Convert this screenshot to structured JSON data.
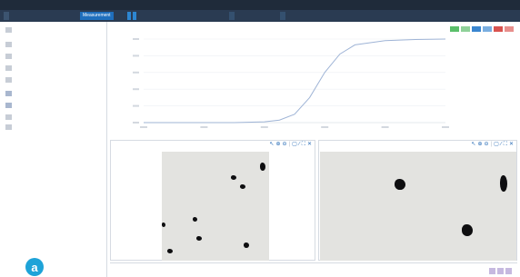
{
  "window": {
    "title": "",
    "controls": [
      "",
      "",
      "",
      ""
    ]
  },
  "tabs": [
    {
      "label": ""
    },
    {
      "label": "Measurement"
    },
    {
      "label": ""
    },
    {
      "label": ""
    },
    {
      "label": ""
    }
  ],
  "run_buttons": [
    "",
    ""
  ],
  "sidebar": {
    "items": [
      {
        "label": "",
        "icon": "expand-icon"
      },
      {
        "label": "",
        "icon": "folder-icon"
      },
      {
        "label": "",
        "icon": "document-icon"
      },
      {
        "label": "",
        "icon": "settings-icon"
      },
      {
        "label": "",
        "icon": "edit-icon"
      },
      {
        "label": "",
        "icon": "image-icon"
      },
      {
        "label": "",
        "icon": "chart-icon"
      },
      {
        "label": "",
        "icon": "grid-icon"
      },
      {
        "label": "",
        "icon": "list-icon"
      }
    ],
    "badge": "a"
  },
  "chart_panel": {
    "title": "",
    "legend_groups": [
      {
        "title": "",
        "lines": [
          "",
          "",
          ""
        ]
      },
      {
        "title": "",
        "lines": [
          "",
          "",
          ""
        ]
      },
      {
        "title": "",
        "lines": [
          "",
          "",
          ""
        ]
      },
      {
        "title": "",
        "lines": [
          "",
          "",
          ""
        ]
      }
    ]
  },
  "chart_data": {
    "type": "line",
    "title": "",
    "xlabel": "",
    "ylabel": "",
    "xlim": [
      0,
      100
    ],
    "ylim": [
      0,
      100
    ],
    "grid": true,
    "series": [
      {
        "color": "#9fb4d6",
        "x": [
          0,
          10,
          20,
          30,
          40,
          45,
          50,
          55,
          60,
          65,
          70,
          80,
          90,
          100
        ],
        "y": [
          0,
          0,
          0,
          0,
          1,
          3,
          10,
          30,
          60,
          82,
          93,
          98,
          99.5,
          100
        ]
      }
    ]
  },
  "image_panels": [
    {
      "title": ""
    },
    {
      "title": ""
    }
  ],
  "colors": {
    "titlebar": "#1f2b3a",
    "tabbar": "#2a3b52",
    "accent": "#1f6fbd",
    "badge": "#1ea3d8"
  }
}
